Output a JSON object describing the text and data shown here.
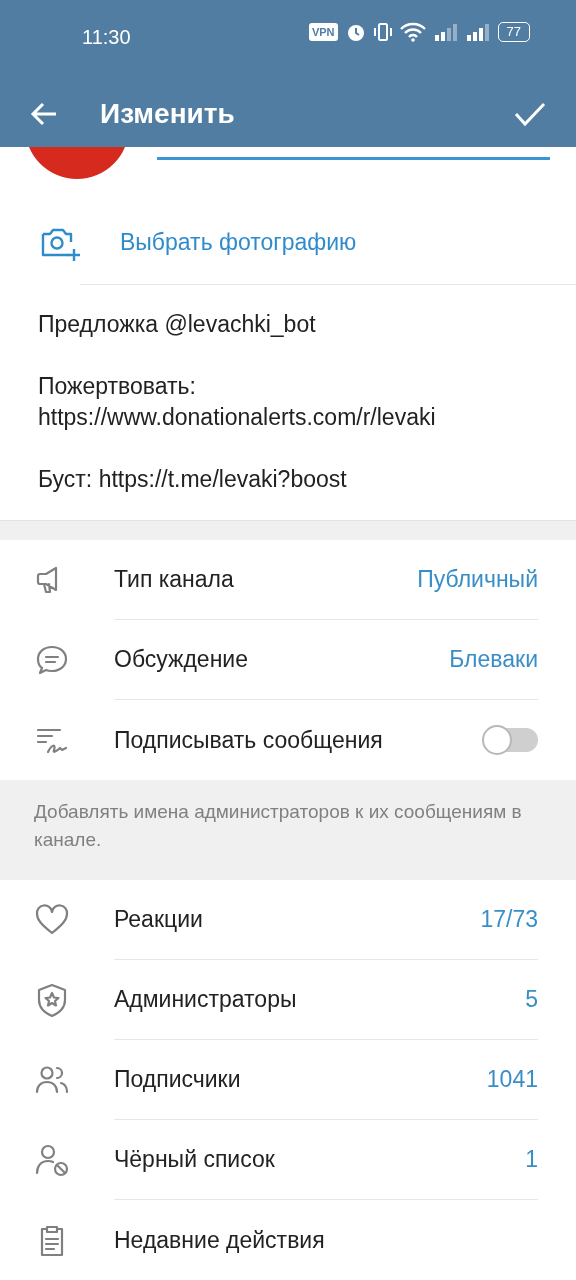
{
  "status_bar": {
    "time": "11:30",
    "vpn": "VPN",
    "battery": "77"
  },
  "app_bar": {
    "title": "Изменить"
  },
  "photo_action": {
    "label": "Выбрать фотографию"
  },
  "description": {
    "value": "Предложка @levachki_bot\n\nПожертвовать:\nhttps://www.donationalerts.com/r/levaki\n\nБуст: https://t.me/levaki?boost"
  },
  "settings": [
    {
      "kind": "value",
      "label": "Тип канала",
      "value": "Публичный"
    },
    {
      "kind": "value",
      "label": "Обсуждение",
      "value": "Блеваки"
    },
    {
      "kind": "toggle",
      "label": "Подписывать сообщения",
      "on": false
    }
  ],
  "settings_hint": "Добавлять имена администраторов к их сообщениям в канале.",
  "management": [
    {
      "label": "Реакции",
      "value": "17/73"
    },
    {
      "label": "Администраторы",
      "value": "5"
    },
    {
      "label": "Подписчики",
      "value": "1041"
    },
    {
      "label": "Чёрный список",
      "value": "1"
    },
    {
      "label": "Недавние действия"
    }
  ]
}
